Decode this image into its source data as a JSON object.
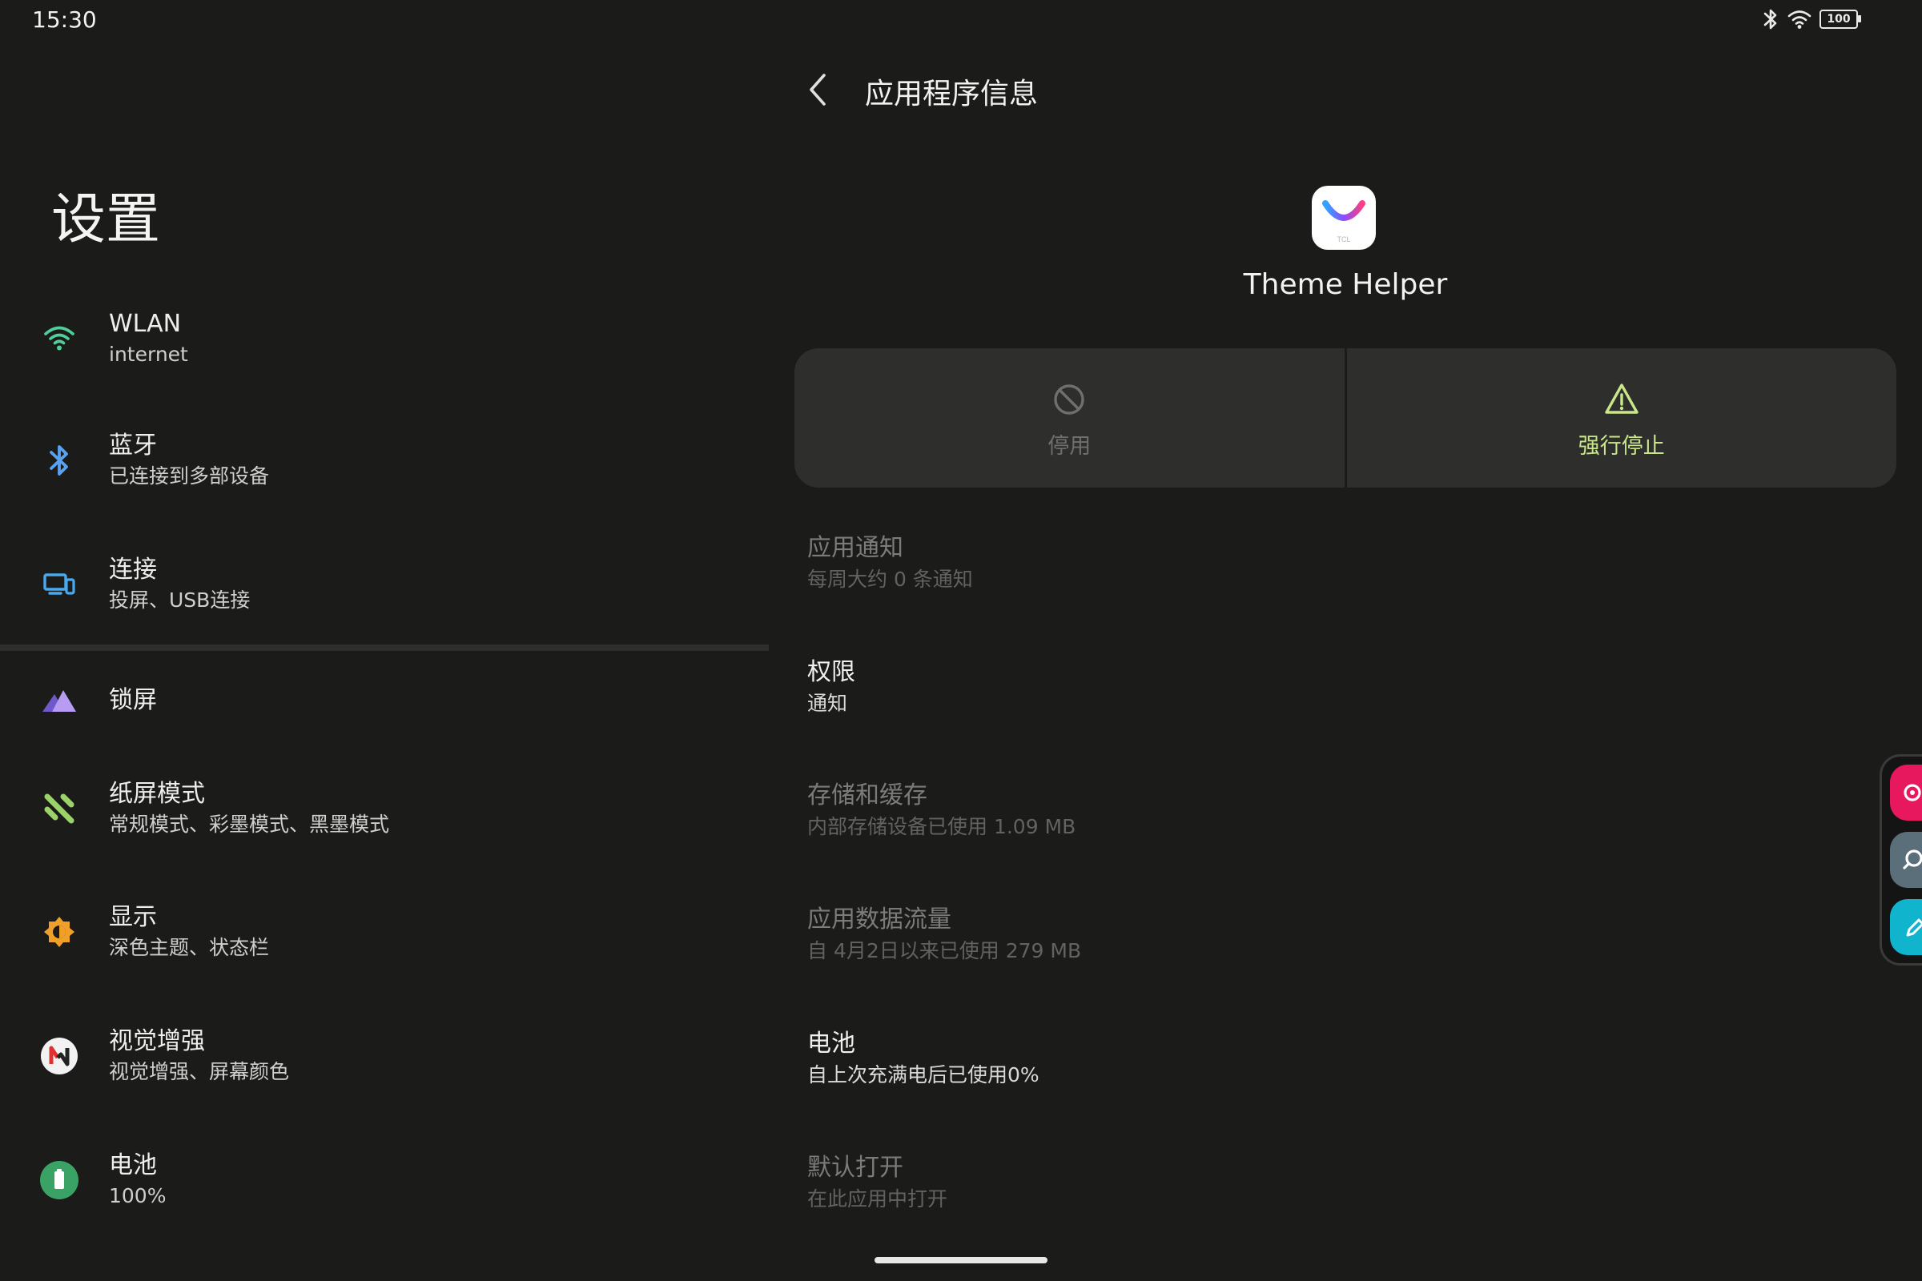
{
  "status_bar": {
    "time": "15:30",
    "battery_level": "100",
    "icons": [
      "bluetooth-icon",
      "wifi-icon",
      "battery-icon"
    ]
  },
  "settings": {
    "title": "设置",
    "items": [
      {
        "label": "WLAN",
        "sub": "internet",
        "icon": "wifi-icon"
      },
      {
        "label": "蓝牙",
        "sub": "已连接到多部设备",
        "icon": "bluetooth-icon"
      },
      {
        "label": "连接",
        "sub": "投屏、USB连接",
        "icon": "devices-icon"
      },
      {
        "label": "锁屏",
        "sub": "",
        "icon": "lockscreen-icon"
      },
      {
        "label": "纸屏模式",
        "sub": "常规模式、彩墨模式、黑墨模式",
        "icon": "paper-mode-icon"
      },
      {
        "label": "显示",
        "sub": "深色主题、状态栏",
        "icon": "display-icon"
      },
      {
        "label": "视觉增强",
        "sub": "视觉增强、屏幕颜色",
        "icon": "visual-enhance-icon"
      },
      {
        "label": "电池",
        "sub": "100%",
        "icon": "battery-icon"
      }
    ]
  },
  "app_info": {
    "title": "应用程序信息",
    "app_name": "Theme Helper",
    "app_icon_brand": "TCL",
    "actions": [
      {
        "label": "停用",
        "enabled": false,
        "icon": "disable-icon"
      },
      {
        "label": "强行停止",
        "enabled": true,
        "icon": "warning-icon"
      }
    ],
    "items": [
      {
        "label": "应用通知",
        "sub": "每周大约 0 条通知",
        "enabled": false
      },
      {
        "label": "权限",
        "sub": "通知",
        "enabled": true
      },
      {
        "label": "存储和缓存",
        "sub": "内部存储设备已使用 1.09 MB",
        "enabled": false
      },
      {
        "label": "应用数据流量",
        "sub": "自 4月2日以来已使用 279 MB",
        "enabled": false
      },
      {
        "label": "电池",
        "sub": "自上次充满电后已使用0%",
        "enabled": true
      },
      {
        "label": "默认打开",
        "sub": "在此应用中打开",
        "enabled": false
      }
    ]
  },
  "colors": {
    "background": "#1b1c1a",
    "card": "#2e2f2c",
    "accent_green": "#c9e68a"
  },
  "floating_toolbar": {
    "buttons": [
      "screenshot-icon",
      "search-icon",
      "pen-icon"
    ]
  }
}
